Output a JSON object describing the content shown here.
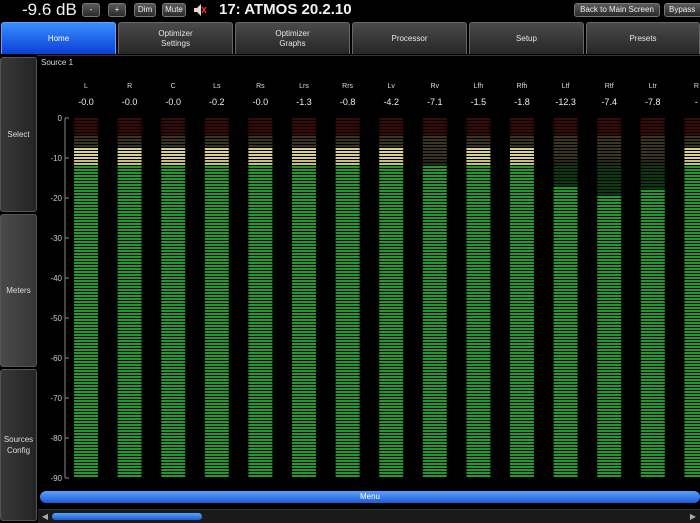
{
  "topbar": {
    "volume": "-9.6 dB",
    "minus_label": "-",
    "plus_label": "+",
    "dim_label": "Dim",
    "mute_label": "Mute",
    "preset_name": "17: ATMOS 20.2.10",
    "back_label": "Back to Main Screen",
    "bypass_label": "Bypass"
  },
  "tabs": [
    {
      "label": "Home",
      "active": true
    },
    {
      "label": "Optimizer Settings",
      "active": false
    },
    {
      "label": "Optimizer Graphs",
      "active": false
    },
    {
      "label": "Processor",
      "active": false
    },
    {
      "label": "Setup",
      "active": false
    },
    {
      "label": "Presets",
      "active": false
    }
  ],
  "sidebar": [
    {
      "label": "Select",
      "active": false
    },
    {
      "label": "Meters",
      "active": true
    },
    {
      "label": "Sources Config",
      "active": false
    }
  ],
  "source_label": "Source 1",
  "scale": [
    "0",
    "-10",
    "-20",
    "-30",
    "-40",
    "-50",
    "-60",
    "-70",
    "-80",
    "-90"
  ],
  "channels": [
    {
      "name": "L",
      "peak": "-0.0",
      "level_db": -7
    },
    {
      "name": "R",
      "peak": "-0.0",
      "level_db": -7
    },
    {
      "name": "C",
      "peak": "-0.0",
      "level_db": -7
    },
    {
      "name": "Ls",
      "peak": "-0.2",
      "level_db": -7
    },
    {
      "name": "Rs",
      "peak": "-0.0",
      "level_db": -7
    },
    {
      "name": "Lrs",
      "peak": "-1.3",
      "level_db": -7
    },
    {
      "name": "Rrs",
      "peak": "-0.8",
      "level_db": -7
    },
    {
      "name": "Lv",
      "peak": "-4.2",
      "level_db": -7
    },
    {
      "name": "Rv",
      "peak": "-7.1",
      "level_db": -12
    },
    {
      "name": "Lfh",
      "peak": "-1.5",
      "level_db": -7
    },
    {
      "name": "Rfh",
      "peak": "-1.8",
      "level_db": -7
    },
    {
      "name": "Ltf",
      "peak": "-12.3",
      "level_db": -17
    },
    {
      "name": "Rtf",
      "peak": "-7.4",
      "level_db": -19
    },
    {
      "name": "Ltr",
      "peak": "-7.8",
      "level_db": -18
    },
    {
      "name": "R",
      "peak": "-",
      "level_db": -7
    }
  ],
  "menu_label": "Menu",
  "colors": {
    "accent": "#1d5ad8",
    "meter_green": "#1f9a2c",
    "meter_yellow": "#c8c080",
    "meter_red": "#8a1b14"
  }
}
